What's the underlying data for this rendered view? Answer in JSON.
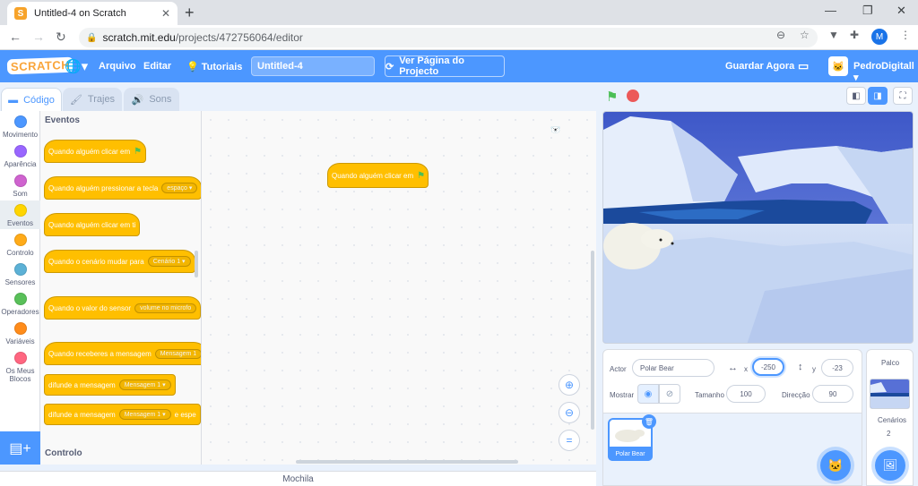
{
  "browser": {
    "tab_title": "Untitled-4 on Scratch",
    "tab_close": "✕",
    "new_tab": "+",
    "url_host": "scratch.mit.edu",
    "url_path": "/projects/472756064/editor",
    "profile_initial": "M",
    "min": "—",
    "restore": "❐",
    "close": "✕"
  },
  "menubar": {
    "logo": "SCRATCH",
    "file": "Arquivo",
    "edit": "Editar",
    "tutorials": "Tutoriais",
    "project_title": "Untitled-4",
    "see_project": "Ver Página do Projecto",
    "save_now": "Guardar Agora",
    "username": "PedroDigitall"
  },
  "tabs": {
    "code": "Código",
    "costumes": "Trajes",
    "sounds": "Sons"
  },
  "categories": [
    {
      "label": "Movimento",
      "color": "#4c97ff"
    },
    {
      "label": "Aparência",
      "color": "#9966ff"
    },
    {
      "label": "Som",
      "color": "#cf63cf"
    },
    {
      "label": "Eventos",
      "color": "#ffd500"
    },
    {
      "label": "Controlo",
      "color": "#ffab19"
    },
    {
      "label": "Sensores",
      "color": "#5cb1d6"
    },
    {
      "label": "Operadores",
      "color": "#59c059"
    },
    {
      "label": "Variáveis",
      "color": "#ff8c1a"
    },
    {
      "label": "Os Meus Blocos",
      "color": "#ff6680"
    }
  ],
  "palette": {
    "heading": "Eventos",
    "heading_next": "Controlo",
    "blocks": {
      "flag_clicked": "Quando alguém clicar em",
      "key_pressed": "Quando alguém pressionar a tecla",
      "key_value": "espaço",
      "sprite_clicked": "Quando alguém clicar em ti",
      "backdrop_switch": "Quando o cenário mudar para",
      "backdrop_value": "Cenário 1",
      "sensor_value": "Quando o valor do sensor",
      "sensor_sel": "volume no microfo",
      "receive": "Quando receberes a mensagem",
      "receive_value": "Mensagem 1",
      "broadcast": "difunde a mensagem",
      "broadcast_value": "Mensagem 1",
      "broadcast_wait": "difunde a mensagem",
      "broadcast_wait_value": "Mensagem 1",
      "broadcast_wait_suffix": "e espe"
    }
  },
  "script": {
    "hat_label": "Quando alguém clicar em"
  },
  "backpack": "Mochila",
  "sprite_info": {
    "actor_label": "Actor",
    "actor_name": "Polar Bear",
    "x_label": "x",
    "x_value": "-250",
    "y_label": "y",
    "y_value": "-23",
    "show_label": "Mostrar",
    "size_label": "Tamanho",
    "size_value": "100",
    "direction_label": "Direcção",
    "direction_value": "90"
  },
  "sprite_list": [
    {
      "name": "Polar Bear"
    }
  ],
  "stage_panel": {
    "title": "Palco",
    "backdrops_label": "Cenários",
    "backdrops_count": "2"
  }
}
